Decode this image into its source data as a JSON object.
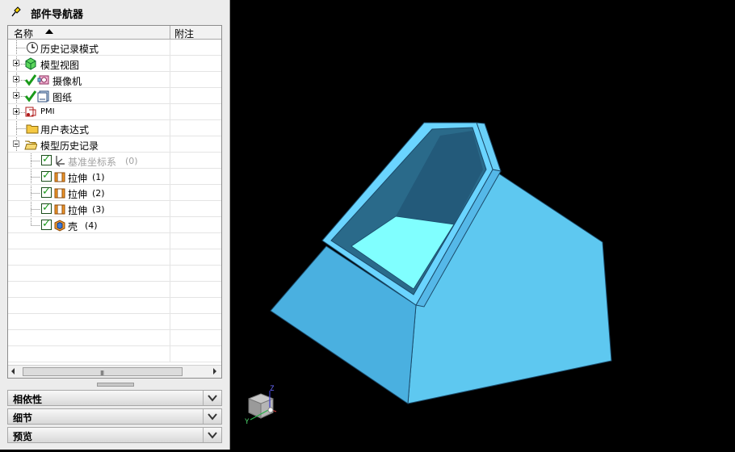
{
  "navigator": {
    "title": "部件导航器",
    "columns": {
      "name": "名称",
      "note": "附注"
    },
    "items": [
      {
        "label": "历史记录模式",
        "number": "",
        "icon": "clock-icon"
      },
      {
        "label": "模型视图",
        "number": "",
        "icon": "model-views-icon"
      },
      {
        "label": "摄像机",
        "number": "",
        "icon": "camera-icon"
      },
      {
        "label": "图纸",
        "number": "",
        "icon": "drawing-icon"
      },
      {
        "label": "PMI",
        "number": "",
        "icon": "pmi-icon"
      },
      {
        "label": "用户表达式",
        "number": "",
        "icon": "folder-icon"
      },
      {
        "label": "模型历史记录",
        "number": "",
        "icon": "folder-open-icon"
      },
      {
        "label": "基准坐标系",
        "number": "(0)",
        "icon": "datum-csys-icon"
      },
      {
        "label": "拉伸",
        "number": "(1)",
        "icon": "extrude-icon"
      },
      {
        "label": "拉伸",
        "number": "(2)",
        "icon": "extrude-icon"
      },
      {
        "label": "拉伸",
        "number": "(3)",
        "icon": "extrude-icon"
      },
      {
        "label": "壳",
        "number": "(4)",
        "icon": "shell-icon"
      }
    ],
    "scroll_grip": "III"
  },
  "panels": [
    {
      "label": "相依性",
      "icon": "chevron-down-icon"
    },
    {
      "label": "细节",
      "icon": "chevron-down-icon"
    },
    {
      "label": "预览",
      "icon": "chevron-down-icon"
    }
  ],
  "viewport": {
    "triad_labels": {
      "x": "X",
      "y": "Y",
      "z": "Z"
    }
  },
  "colors": {
    "model_face": "#5ec8f0",
    "model_face_dark": "#4ab0e0",
    "model_inner": "#2a6a8a",
    "model_floor": "#80ffff",
    "background": "#000000",
    "check_green": "#1a9a1a"
  }
}
